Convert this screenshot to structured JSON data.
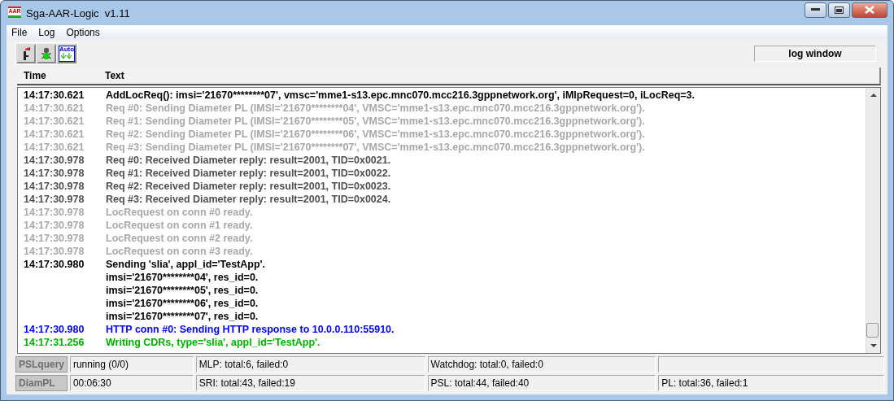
{
  "window": {
    "title": "Sga-AAR-Logic  v1.11",
    "app_icon_text": "AAR"
  },
  "menu": [
    "File",
    "Log",
    "Options"
  ],
  "toolbar": {
    "auto_label": "Auto",
    "panel_label": "log window"
  },
  "log": {
    "columns": [
      "Time",
      "Text"
    ],
    "rows": [
      {
        "time": "14:17:30.621",
        "text": "AddLocReq(): imsi='21670********07', vmsc='mme1-s13.epc.mnc070.mcc216.3gppnetwork.org', iMlpRequest=0, iLocReq=3.",
        "color": "#000000"
      },
      {
        "time": "14:17:30.621",
        "text": "Req #0: Sending Diameter PL (IMSI='21670********04', VMSC='mme1-s13.epc.mnc070.mcc216.3gppnetwork.org').",
        "color": "#a8a8a8"
      },
      {
        "time": "14:17:30.621",
        "text": "Req #1: Sending Diameter PL (IMSI='21670********05', VMSC='mme1-s13.epc.mnc070.mcc216.3gppnetwork.org').",
        "color": "#a8a8a8"
      },
      {
        "time": "14:17:30.621",
        "text": "Req #2: Sending Diameter PL (IMSI='21670********06', VMSC='mme1-s13.epc.mnc070.mcc216.3gppnetwork.org').",
        "color": "#a8a8a8"
      },
      {
        "time": "14:17:30.621",
        "text": "Req #3: Sending Diameter PL (IMSI='21670********07', VMSC='mme1-s13.epc.mnc070.mcc216.3gppnetwork.org').",
        "color": "#a8a8a8"
      },
      {
        "time": "14:17:30.978",
        "text": "Req #0: Received Diameter reply: result=2001, TID=0x0021.",
        "color": "#505050"
      },
      {
        "time": "14:17:30.978",
        "text": "Req #1: Received Diameter reply: result=2001, TID=0x0022.",
        "color": "#505050"
      },
      {
        "time": "14:17:30.978",
        "text": "Req #2: Received Diameter reply: result=2001, TID=0x0023.",
        "color": "#505050"
      },
      {
        "time": "14:17:30.978",
        "text": "Req #3: Received Diameter reply: result=2001, TID=0x0024.",
        "color": "#505050"
      },
      {
        "time": "14:17:30.978",
        "text": "LocRequest on conn #0 ready.",
        "color": "#a8a8a8"
      },
      {
        "time": "14:17:30.978",
        "text": "LocRequest on conn #1 ready.",
        "color": "#a8a8a8"
      },
      {
        "time": "14:17:30.978",
        "text": "LocRequest on conn #2 ready.",
        "color": "#a8a8a8"
      },
      {
        "time": "14:17:30.978",
        "text": "LocRequest on conn #3 ready.",
        "color": "#a8a8a8"
      },
      {
        "time": "14:17:30.980",
        "text": "Sending 'slia', appl_id='TestApp'.",
        "color": "#000000"
      },
      {
        "text": "imsi='21670********04', res_id=0.",
        "color": "#000000"
      },
      {
        "text": "imsi='21670********05', res_id=0.",
        "color": "#000000"
      },
      {
        "text": "imsi='21670********06', res_id=0.",
        "color": "#000000"
      },
      {
        "text": "imsi='21670********07', res_id=0.",
        "color": "#000000"
      },
      {
        "time": "14:17:30.980",
        "text": "HTTP conn #0: Sending HTTP response to 10.0.0.110:55910.",
        "color": "#0000ff"
      },
      {
        "time": "14:17:31.256",
        "text": "Writing CDRs, type='slia', appl_id='TestApp'.",
        "color": "#00b000"
      }
    ]
  },
  "status_rows": [
    {
      "label": "PSLquery",
      "cells": [
        "running (0/0)",
        "MLP: total:6, failed:0",
        "Watchdog: total:0, failed:0"
      ]
    },
    {
      "label": "DiamPL",
      "cells": [
        "00:06:30",
        "SRI: total:43, failed:19",
        "PSL: total:44, failed:40",
        "PL: total:36, failed:1"
      ]
    }
  ]
}
